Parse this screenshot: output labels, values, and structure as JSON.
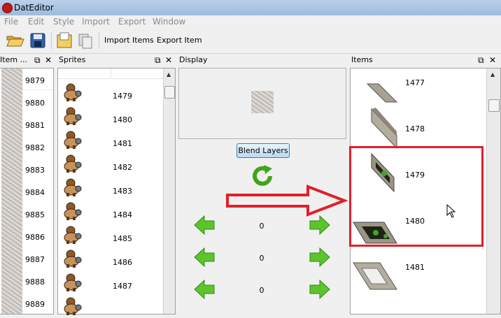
{
  "window": {
    "title": "DatEditor"
  },
  "menu": [
    "File",
    "Edit",
    "Style",
    "Import",
    "Export",
    "Window"
  ],
  "toolbar": {
    "import_items": "Import Items",
    "export_item": "Export Item"
  },
  "panels": {
    "item_panel": {
      "title": "Item ...",
      "rows": [
        "9879",
        "9880",
        "9881",
        "9882",
        "9883",
        "9884",
        "9885",
        "9886",
        "9887",
        "9888",
        "9889"
      ]
    },
    "sprites": {
      "title": "Sprites",
      "rows": [
        "1479",
        "1480",
        "1481",
        "1482",
        "1483",
        "1484",
        "1485",
        "1486",
        "1487"
      ]
    },
    "display": {
      "title": "Display",
      "blend_button": "Blend Layers",
      "values": [
        "0",
        "0",
        "0"
      ]
    },
    "items": {
      "title": "Items",
      "rows": [
        "1477",
        "1478",
        "1479",
        "1480",
        "1481"
      ]
    }
  },
  "colors": {
    "highlight_red": "#e0202a",
    "arrow_green": "#4cb81c",
    "selection_bg": "#ffffff"
  }
}
